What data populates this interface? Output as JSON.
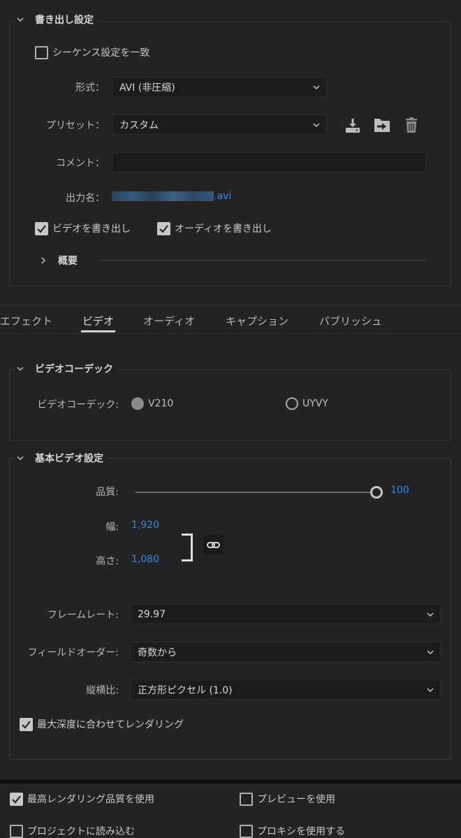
{
  "export_settings": {
    "title": "書き出し設定",
    "match_sequence": "シーケンス設定を一致",
    "format_label": "形式：",
    "format_value": "AVI (非圧縮)",
    "preset_label": "プリセット：",
    "preset_value": "カスタム",
    "comment_label": "コメント：",
    "comment_value": "",
    "output_name_label": "出力名：",
    "output_name_ext": ".avi",
    "export_video": "ビデオを書き出し",
    "export_audio": "オーディオを書き出し",
    "summary": "概要"
  },
  "tabs": [
    "エフェクト",
    "ビデオ",
    "オーディオ",
    "キャプション",
    "パブリッシュ"
  ],
  "active_tab": "ビデオ",
  "video_codec": {
    "title": "ビデオコーデック",
    "label": "ビデオコーデック:",
    "options": [
      "V210",
      "UYVY"
    ],
    "selected": "V210"
  },
  "basic_video": {
    "title": "基本ビデオ設定",
    "quality_label": "品質:",
    "quality_value": "100",
    "quality_level": 1.0,
    "width_label": "幅:",
    "width_value": "1,920",
    "height_label": "高さ:",
    "height_value": "1,080",
    "frame_rate_label": "フレームレート:",
    "frame_rate_value": "29.97",
    "field_order_label": "フィールドオーダー:",
    "field_order_value": "奇数から",
    "aspect_label": "縦横比:",
    "aspect_value": "正方形ピクセル (1.0)",
    "max_depth": "最大深度に合わせてレンダリング"
  },
  "footer": {
    "max_quality": "最高レンダリング品質を使用",
    "use_preview": "プレビューを使用",
    "import_project": "プロジェクトに読み込む",
    "use_proxy": "プロキシを使用する"
  },
  "colors": {
    "background": "#232323",
    "accent_blue": "#2d8ceb",
    "text": "#c8c8c8"
  },
  "icons": [
    "chevron-down-icon",
    "chevron-right-icon",
    "dropdown-caret-icon",
    "save-preset-icon",
    "import-preset-icon",
    "delete-preset-icon",
    "link-icon",
    "checkmark-icon"
  ]
}
